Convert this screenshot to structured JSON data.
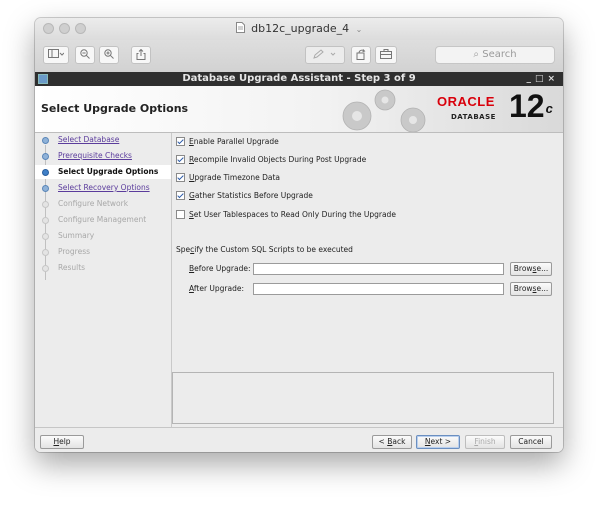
{
  "mac": {
    "window_title": "db12c_upgrade_4",
    "search_placeholder": "Search"
  },
  "app": {
    "title": "Database Upgrade Assistant - Step 3 of 9",
    "page_title": "Select Upgrade Options",
    "logo_oracle": "ORACLE",
    "logo_database": "DATABASE",
    "logo_version": "12",
    "logo_version_suffix": "c"
  },
  "sidebar": {
    "items": [
      {
        "label": "Select Database",
        "state": "link"
      },
      {
        "label": "Prerequisite Checks",
        "state": "link"
      },
      {
        "label": "Select Upgrade Options",
        "state": "current"
      },
      {
        "label": "Select Recovery Options",
        "state": "link"
      },
      {
        "label": "Configure Network",
        "state": "disabled"
      },
      {
        "label": "Configure Management",
        "state": "disabled"
      },
      {
        "label": "Summary",
        "state": "disabled"
      },
      {
        "label": "Progress",
        "state": "disabled"
      },
      {
        "label": "Results",
        "state": "disabled"
      }
    ]
  },
  "options": {
    "parallel": {
      "mnemonic": "E",
      "rest": "nable Parallel Upgrade",
      "checked": true
    },
    "recompile": {
      "mnemonic": "R",
      "rest": "ecompile Invalid Objects During Post Upgrade",
      "checked": true
    },
    "timezone": {
      "mnemonic": "U",
      "rest": "pgrade Timezone Data",
      "checked": true
    },
    "stats": {
      "mnemonic": "G",
      "rest": "ather Statistics Before Upgrade",
      "checked": true
    },
    "readonly": {
      "mnemonic": "S",
      "rest": "et User Tablespaces to Read Only During the Upgrade",
      "checked": false
    }
  },
  "scripts": {
    "label_pre": "Spe",
    "label_mnemonic": "c",
    "label_post": "ify the Custom SQL Scripts to be executed",
    "before": {
      "mnemonic": "B",
      "rest": "efore Upgrade:",
      "value": ""
    },
    "after": {
      "mnemonic": "A",
      "rest": "fter Upgrade:",
      "value": ""
    },
    "browse_pre": "Brow",
    "browse_mnemonic": "s",
    "browse_post": "e..."
  },
  "footer": {
    "help_mnemonic": "H",
    "help_rest": "elp",
    "back_pre": "< ",
    "back_mnemonic": "B",
    "back_rest": "ack",
    "next_mnemonic": "N",
    "next_rest": "ext >",
    "finish_mnemonic": "F",
    "finish_rest": "inish",
    "cancel": "Cancel"
  }
}
